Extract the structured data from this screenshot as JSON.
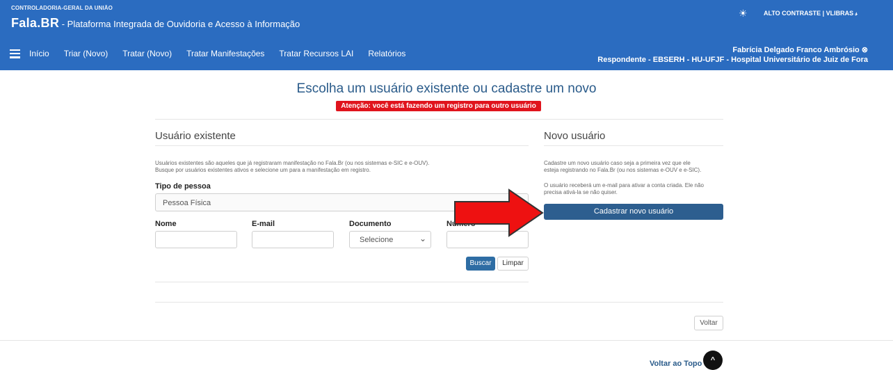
{
  "header": {
    "org": "CONTROLADORIA-GERAL DA UNIÃO",
    "brand": "Fala.BR",
    "subtitle": " - Plataforma Integrada de Ouvidoria e Acesso à Informação",
    "contrast_icon": "☀",
    "accessibility": "ALTO CONTRASTE  |  VLIBRAS 𝓈",
    "nav": [
      "Início",
      "Triar (Novo)",
      "Tratar (Novo)",
      "Tratar Manifestações",
      "Tratar Recursos LAI",
      "Relatórios"
    ],
    "user_name": "Fabrícia Delgado Franco Ambrósio ⊗",
    "user_role": "Respondente - EBSERH - HU-UFJF - Hospital Universitário de Juiz de Fora"
  },
  "main": {
    "title": "Escolha um usuário existente ou cadastre um novo",
    "warning": "Atenção: você está fazendo um registro para outro usuário"
  },
  "existing": {
    "title": "Usuário existente",
    "desc1": "Usuários existentes são aqueles que já registraram manifestação no Fala.Br (ou nos sistemas e-SIC e e-OUV).",
    "desc2": "Busque por usuários existentes ativos e selecione um para a manifestação em registro.",
    "person_type_label": "Tipo de pessoa",
    "person_type_value": "Pessoa Física",
    "name_label": "Nome",
    "email_label": "E-mail",
    "document_label": "Documento",
    "document_value": "Selecione",
    "number_label": "Número",
    "search_button": "Buscar",
    "clear_button": "Limpar"
  },
  "new_user": {
    "title": "Novo usuário",
    "desc1": "Cadastre um novo usuário caso seja a primeira vez que ele",
    "desc2": "esteja registrando no Fala.Br (ou nos sistemas e-OUV e e-SIC).",
    "desc3": "O usuário receberá um e-mail para ativar a conta criada. Ele não",
    "desc4": "precisa ativá-la se não quiser.",
    "register_button": "Cadastrar novo usuário"
  },
  "footer": {
    "back_button": "Voltar",
    "top_link": "Voltar ao Topo",
    "top_icon": "^"
  },
  "colors": {
    "header_bg": "#2b6cc0",
    "warning_bg": "#e0141d",
    "primary_button": "#2d5e8f",
    "arrow": "#ee1111"
  },
  "icons": [
    "hamburger-menu-icon",
    "sun-contrast-icon",
    "chevron-down-icon",
    "close-circle-icon",
    "red-arrow-annotation",
    "chevron-up-icon"
  ]
}
